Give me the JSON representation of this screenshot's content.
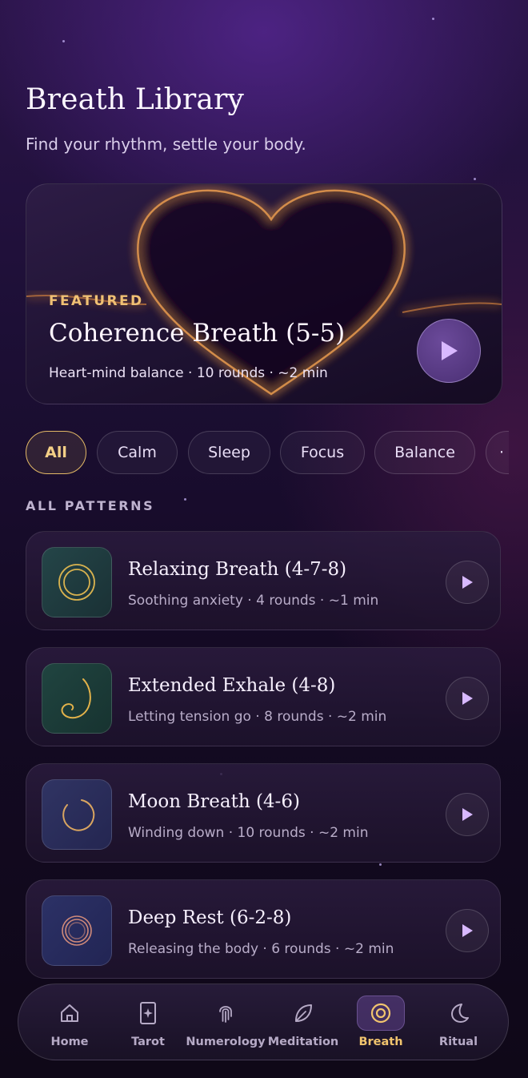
{
  "header": {
    "title": "Breath Library",
    "subtitle": "Find your rhythm, settle your body."
  },
  "featured": {
    "label": "FEATURED",
    "title": "Coherence Breath (5-5)",
    "meta": "Heart-mind balance · 10 rounds · ~2 min",
    "play_icon": "play-icon"
  },
  "filters": {
    "chips": [
      {
        "label": "All",
        "active": true
      },
      {
        "label": "Calm",
        "active": false
      },
      {
        "label": "Sleep",
        "active": false
      },
      {
        "label": "Focus",
        "active": false
      },
      {
        "label": "Balance",
        "active": false
      },
      {
        "label": "·",
        "active": false
      }
    ]
  },
  "section": {
    "label": "ALL PATTERNS"
  },
  "patterns": [
    {
      "title": "Relaxing Breath (4-7-8)",
      "meta": "Soothing anxiety · 4 rounds · ~1 min",
      "icon": "double-circle-icon",
      "thumb_color": "#1f3b3f"
    },
    {
      "title": "Extended Exhale (4-8)",
      "meta": "Letting tension go · 8 rounds · ~2 min",
      "icon": "spiral-exhale-icon",
      "thumb_color": "#1d3a36"
    },
    {
      "title": "Moon Breath (4-6)",
      "meta": "Winding down · 10 rounds · ~2 min",
      "icon": "crescent-ring-icon",
      "thumb_color": "#2c2d57"
    },
    {
      "title": "Deep Rest (6-2-8)",
      "meta": "Releasing the body · 6 rounds · ~2 min",
      "icon": "concentric-rings-icon",
      "thumb_color": "#25295a"
    }
  ],
  "nav": {
    "items": [
      {
        "label": "Home",
        "icon": "home-icon",
        "active": false
      },
      {
        "label": "Tarot",
        "icon": "tarot-card-icon",
        "active": false
      },
      {
        "label": "Numerology",
        "icon": "fingerprint-icon",
        "active": false
      },
      {
        "label": "Meditation",
        "icon": "leaf-icon",
        "active": false
      },
      {
        "label": "Breath",
        "icon": "breath-circle-icon",
        "active": true
      },
      {
        "label": "Ritual",
        "icon": "moon-icon",
        "active": false
      }
    ]
  },
  "colors": {
    "accent_gold": "#f0c074",
    "play_purple": "#d8b8ff",
    "background": "#1d0f36"
  }
}
